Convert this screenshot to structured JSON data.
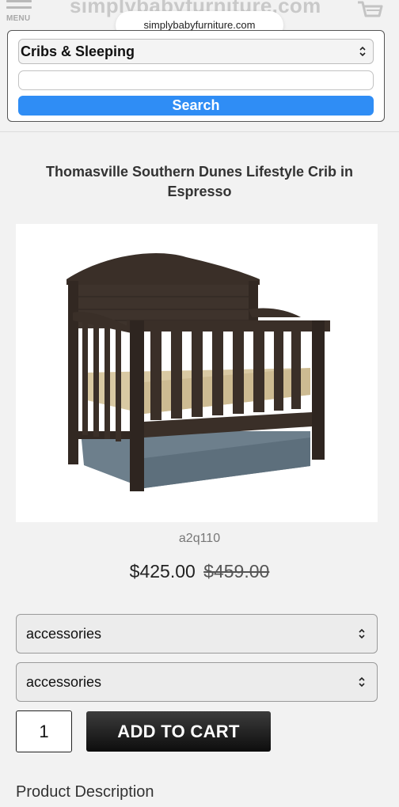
{
  "header": {
    "menu_label": "MENU",
    "logo_text": "simplybabyfurniture.com",
    "url": "simplybabyfurniture.com"
  },
  "search": {
    "category": "Cribs & Sleeping",
    "query": "",
    "button_label": "Search"
  },
  "product": {
    "title": "Thomasville Southern Dunes Lifestyle Crib in Espresso",
    "sku": "a2q110",
    "price": "$425.00",
    "original_price": "$459.00",
    "option1": "accessories",
    "option2": "accessories",
    "quantity": "1",
    "add_to_cart_label": "ADD TO CART",
    "description_heading": "Product Description"
  },
  "colors": {
    "search_button": "#2f8df5",
    "crib_wood": "#3a2f28",
    "mattress": "#d9c9a3",
    "bed_skirt": "#6d7f8c"
  },
  "icons": [
    "hamburger-menu-icon",
    "cart-icon",
    "chevron-updown-icon"
  ]
}
